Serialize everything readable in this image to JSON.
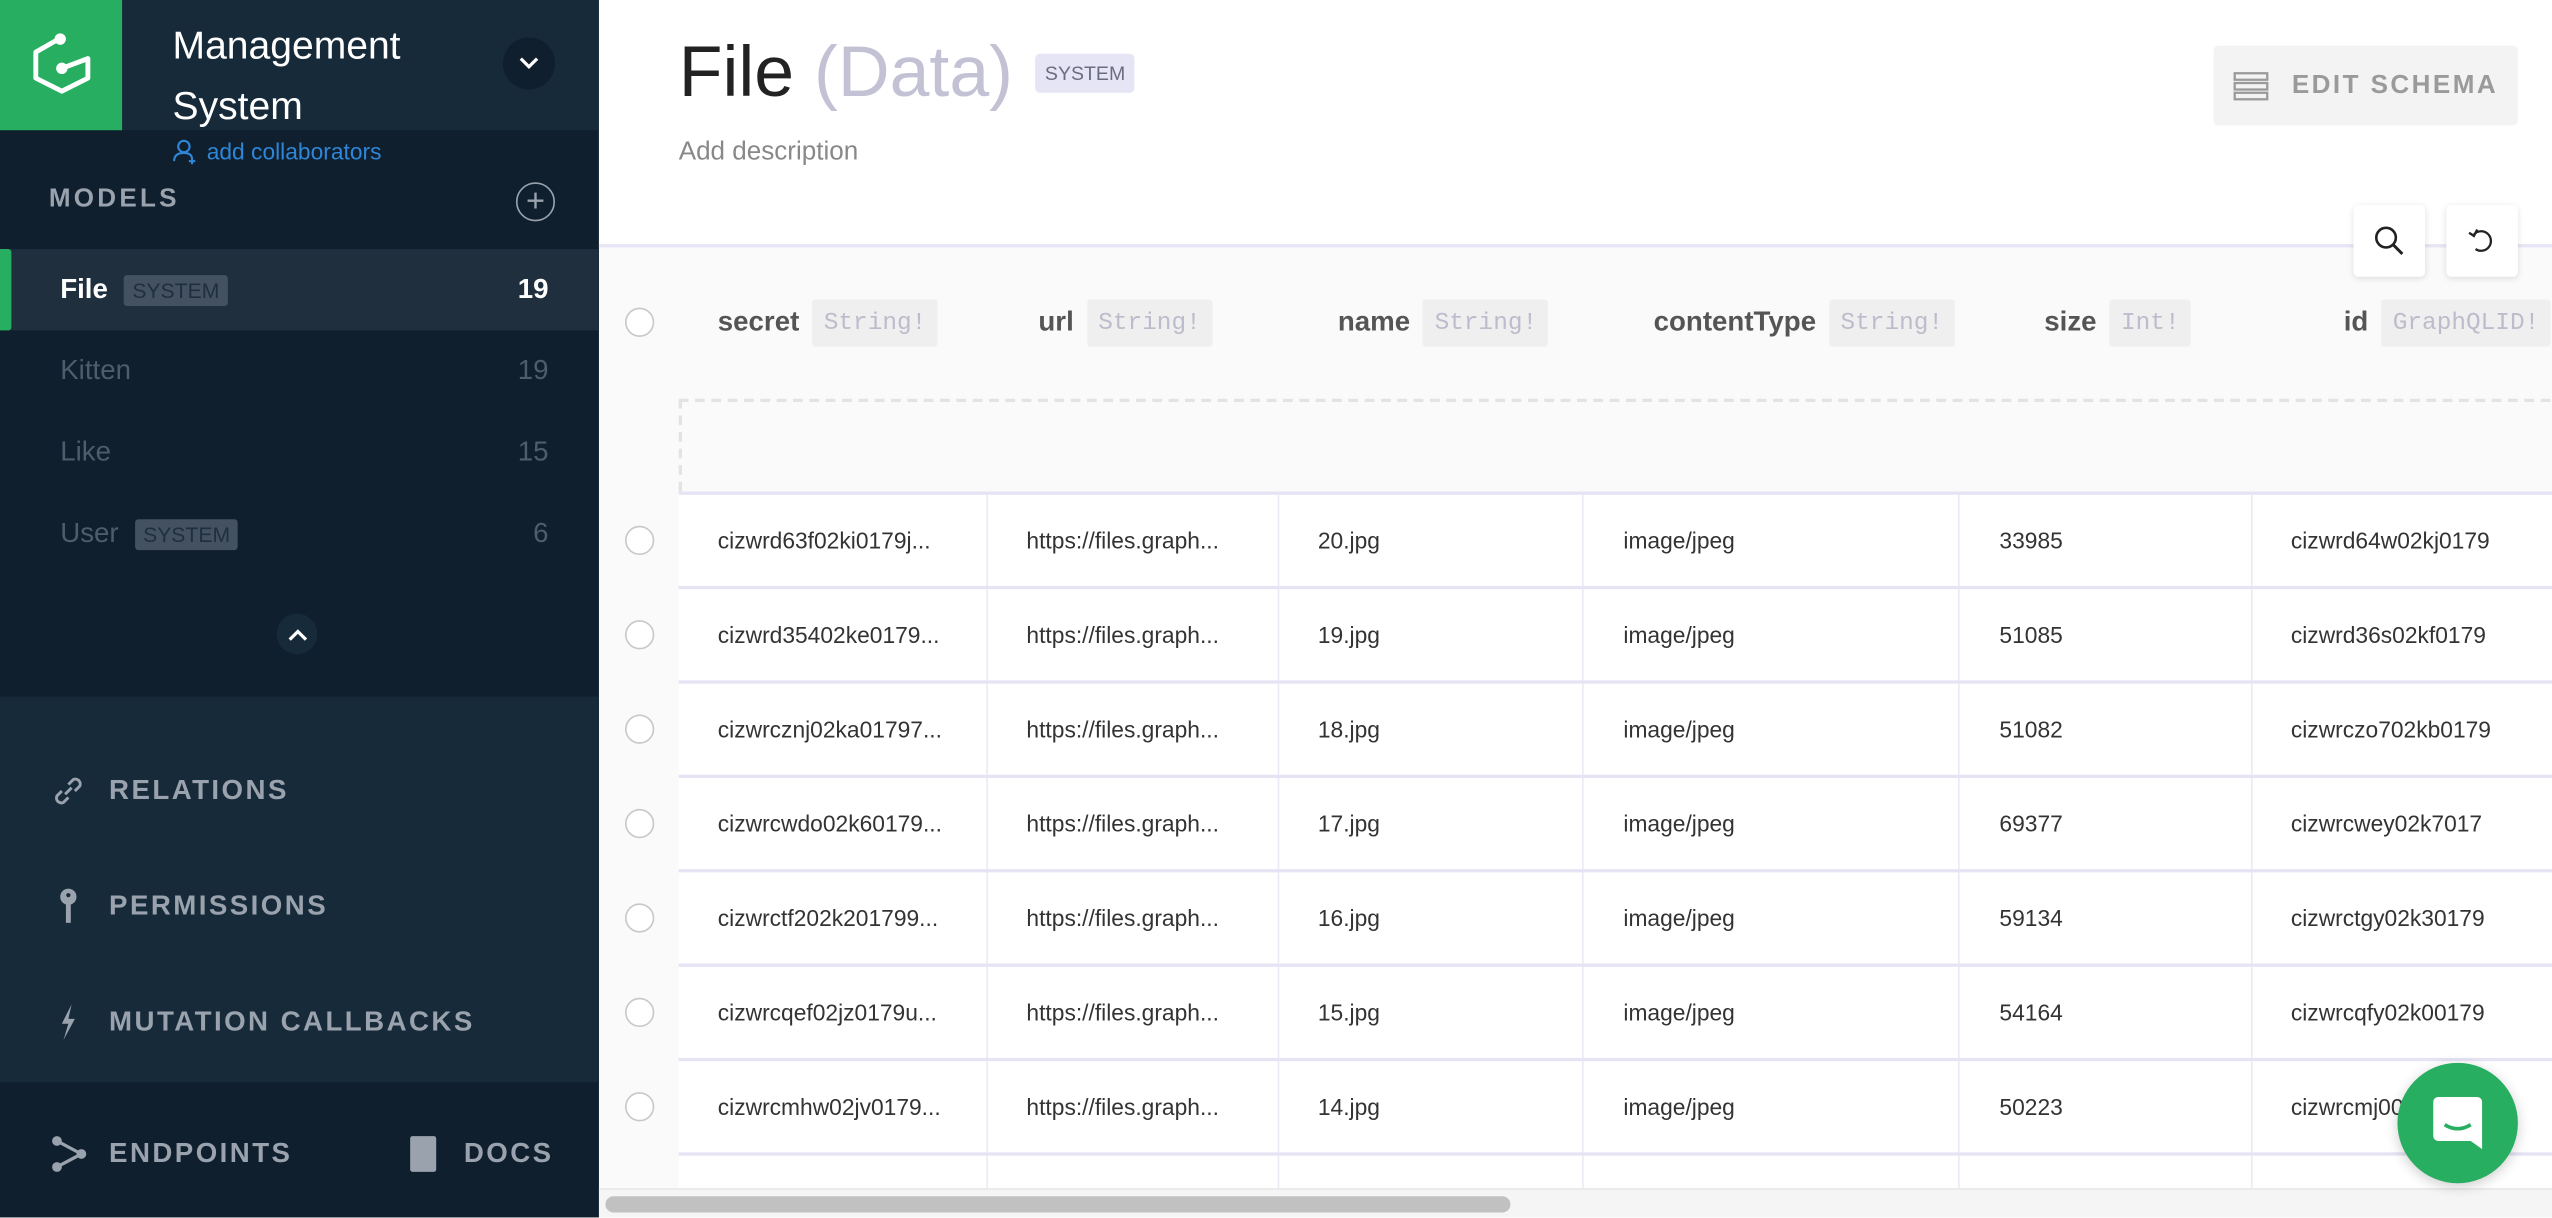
{
  "sidebar": {
    "project_title": "Management System",
    "add_collaborators": "add collaborators",
    "models_label": "MODELS",
    "models": [
      {
        "name": "File",
        "badge": "SYSTEM",
        "count": "19",
        "active": true
      },
      {
        "name": "Kitten",
        "badge": "",
        "count": "19",
        "active": false
      },
      {
        "name": "Like",
        "badge": "",
        "count": "15",
        "active": false
      },
      {
        "name": "User",
        "badge": "SYSTEM",
        "count": "6",
        "active": false
      }
    ],
    "nav": {
      "relations": "RELATIONS",
      "permissions": "PERMISSIONS",
      "mutation_callbacks": "MUTATION CALLBACKS"
    },
    "footer": {
      "endpoints": "ENDPOINTS",
      "docs": "DOCS"
    }
  },
  "header": {
    "title": "File",
    "subtitle": "(Data)",
    "badge": "SYSTEM",
    "description": "Add description",
    "edit_schema": "EDIT SCHEMA"
  },
  "table": {
    "columns": [
      {
        "name": "secret",
        "type": "String!"
      },
      {
        "name": "url",
        "type": "String!"
      },
      {
        "name": "name",
        "type": "String!"
      },
      {
        "name": "contentType",
        "type": "String!"
      },
      {
        "name": "size",
        "type": "Int!"
      },
      {
        "name": "id",
        "type": "GraphQLID!"
      }
    ],
    "rows": [
      [
        "cizwrd63f02ki0179j...",
        "https://files.graph...",
        "20.jpg",
        "image/jpeg",
        "33985",
        "cizwrd64w02kj0179"
      ],
      [
        "cizwrd35402ke0179...",
        "https://files.graph...",
        "19.jpg",
        "image/jpeg",
        "51085",
        "cizwrd36s02kf0179"
      ],
      [
        "cizwrcznj02ka01797...",
        "https://files.graph...",
        "18.jpg",
        "image/jpeg",
        "51082",
        "cizwrczo702kb0179"
      ],
      [
        "cizwrcwdo02k60179...",
        "https://files.graph...",
        "17.jpg",
        "image/jpeg",
        "69377",
        "cizwrcwey02k7017"
      ],
      [
        "cizwrctf202k201799...",
        "https://files.graph...",
        "16.jpg",
        "image/jpeg",
        "59134",
        "cizwrctgy02k30179"
      ],
      [
        "cizwrcqef02jz0179u...",
        "https://files.graph...",
        "15.jpg",
        "image/jpeg",
        "54164",
        "cizwrcqfy02k00179"
      ],
      [
        "cizwrcmhw02jv0179...",
        "https://files.graph...",
        "14.jpg",
        "image/jpeg",
        "50223",
        "cizwrcmj002jw0179"
      ]
    ]
  },
  "colors": {
    "brand": "#27ae60",
    "sidebar": "#0f1f2e",
    "link": "#2f86d6"
  }
}
